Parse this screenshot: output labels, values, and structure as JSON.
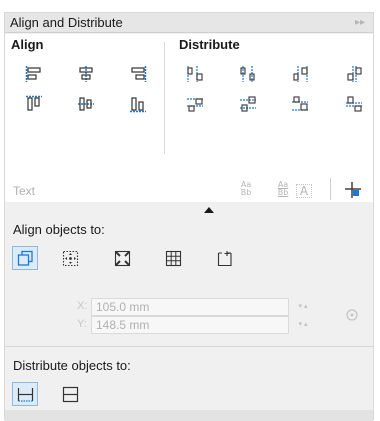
{
  "panel": {
    "title": "Align and Distribute",
    "expand_icon": "double-chevron-right-icon"
  },
  "align": {
    "label": "Align",
    "buttons": [
      {
        "name": "align-left",
        "icon": "align-left-icon"
      },
      {
        "name": "align-center-horizontal",
        "icon": "align-center-horizontal-icon"
      },
      {
        "name": "align-right",
        "icon": "align-right-icon"
      },
      {
        "name": "align-top",
        "icon": "align-top-icon"
      },
      {
        "name": "align-center-vertical",
        "icon": "align-center-vertical-icon"
      },
      {
        "name": "align-bottom",
        "icon": "align-bottom-icon"
      }
    ]
  },
  "distribute": {
    "label": "Distribute",
    "buttons": [
      {
        "name": "distribute-left",
        "icon": "distribute-left-icon"
      },
      {
        "name": "distribute-center-horizontal",
        "icon": "distribute-center-horizontal-icon"
      },
      {
        "name": "distribute-right",
        "icon": "distribute-right-icon"
      },
      {
        "name": "distribute-spacing-horizontal",
        "icon": "distribute-spacing-horizontal-icon"
      },
      {
        "name": "distribute-top",
        "icon": "distribute-top-icon"
      },
      {
        "name": "distribute-center-vertical",
        "icon": "distribute-center-vertical-icon"
      },
      {
        "name": "distribute-bottom",
        "icon": "distribute-bottom-icon"
      },
      {
        "name": "distribute-spacing-vertical",
        "icon": "distribute-spacing-vertical-icon"
      }
    ]
  },
  "text_row": {
    "label": "Text",
    "icon_text": "Aa",
    "icon_text2": "Bb",
    "icon_text3": "A"
  },
  "align_objects_to": {
    "label": "Align objects to:",
    "buttons": [
      {
        "name": "active-objects",
        "icon": "active-objects-icon",
        "active": true
      },
      {
        "name": "page-edge",
        "icon": "page-edge-icon"
      },
      {
        "name": "page-center",
        "icon": "page-center-icon"
      },
      {
        "name": "grid",
        "icon": "grid-icon"
      },
      {
        "name": "specified-point",
        "icon": "specified-point-icon"
      }
    ],
    "x_label": "X:",
    "x_value": "105.0 mm",
    "y_label": "Y:",
    "y_value": "148.5 mm",
    "point_icon": "target-point-icon"
  },
  "distribute_objects_to": {
    "label": "Distribute objects to:",
    "buttons": [
      {
        "name": "selection-extent",
        "icon": "selection-extent-icon",
        "active": true
      },
      {
        "name": "page-extent",
        "icon": "page-extent-icon"
      }
    ]
  },
  "colors": {
    "accent": "#1e78d2",
    "active_bg": "#dcebf8"
  }
}
